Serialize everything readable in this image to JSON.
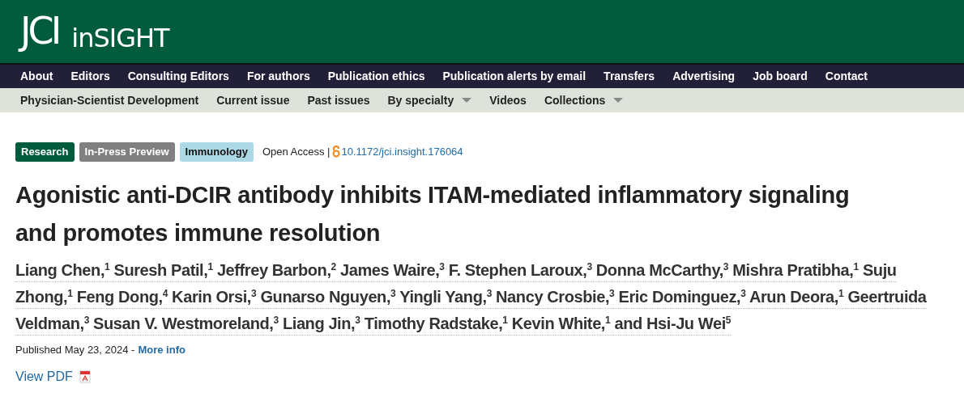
{
  "logo": {
    "main": "JCI",
    "sub": "inSIGHT"
  },
  "main_nav": [
    "About",
    "Editors",
    "Consulting Editors",
    "For authors",
    "Publication ethics",
    "Publication alerts by email",
    "Transfers",
    "Advertising",
    "Job board",
    "Contact"
  ],
  "sub_nav": [
    {
      "label": "Physician-Scientist Development",
      "has_menu": false
    },
    {
      "label": "Current issue",
      "has_menu": false
    },
    {
      "label": "Past issues",
      "has_menu": false
    },
    {
      "label": "By specialty",
      "has_menu": true
    },
    {
      "label": "Videos",
      "has_menu": false
    },
    {
      "label": "Collections",
      "has_menu": true
    }
  ],
  "tags": [
    {
      "label": "Research",
      "color": "#005c3c"
    },
    {
      "label": "In-Press Preview",
      "color": "#808080"
    },
    {
      "label": "Immunology",
      "color": "#add8e6"
    }
  ],
  "access": "Open Access |",
  "doi": "10.1172/jci.insight.176064",
  "title": "Agonistic anti-DCIR antibody inhibits ITAM-mediated inflammatory signaling and promotes immune resolution",
  "authors": "Liang Chen,$^{1}$ Suresh Patil,$^{1}$ Jeffrey Barbon,$^{2}$ James Waire,$^{3}$ F. Stephen Laroux,$^{3}$ Donna McCarthy,$^{3}$ Mishra Pratibha,$^{1}$ Suju Zhong,$^{1}$ Feng Dong,$^{4}$ Karin Orsi,$^{3}$ Gunarso Nguyen,$^{3}$ Yingli Yang,$^{3}$ Nancy Crosbie,$^{3}$ Eric Dominguez,$^{3}$ Arun Deora,$^{1}$ Geertruida Veldman,$^{3}$ Susan V. Westmoreland,$^{3}$ Liang Jin,$^{3}$ Timothy Radstake,$^{1}$ Kevin White,$^{1}$ and Hsi-Ju Wei$^{5}$",
  "published": "Published May 23, 2024 -",
  "more_info": "More info",
  "view_pdf": "View PDF"
}
